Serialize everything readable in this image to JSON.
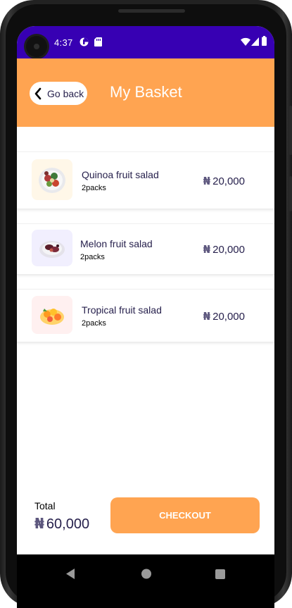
{
  "status": {
    "time": "4:37"
  },
  "header": {
    "back_label": "Go back",
    "title": "My Basket"
  },
  "basket": {
    "items": [
      {
        "name": "Quinoa fruit salad",
        "packs": "2packs",
        "currency": "₦",
        "price": "20,000",
        "thumb_bg": "#fff7e8"
      },
      {
        "name": "Melon fruit salad",
        "packs": "2packs",
        "currency": "₦",
        "price": "20,000",
        "thumb_bg": "#f1effe"
      },
      {
        "name": "Tropical fruit salad",
        "packs": "2packs",
        "currency": "₦",
        "price": "20,000",
        "thumb_bg": "#fff0f0"
      }
    ]
  },
  "footer": {
    "total_label": "Total",
    "total_currency": "₦",
    "total_value": "60,000",
    "checkout_label": "CHECKOUT"
  },
  "colors": {
    "accent": "#ffa451",
    "statusbar": "#3700b3",
    "text_dark": "#27214d"
  }
}
